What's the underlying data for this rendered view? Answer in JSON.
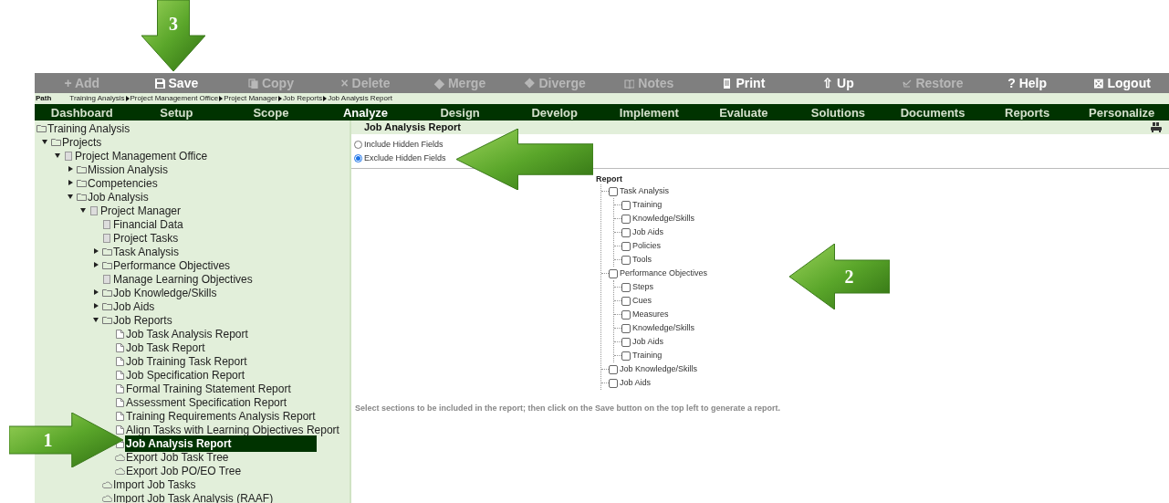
{
  "toolbar": [
    {
      "label": "Add",
      "glyph": "+",
      "disabled": true
    },
    {
      "label": "Save",
      "kind": "floppy",
      "disabled": false
    },
    {
      "label": "Copy",
      "kind": "copy",
      "disabled": true
    },
    {
      "label": "Delete",
      "glyph": "×",
      "disabled": true
    },
    {
      "label": "Merge",
      "glyph": "◆",
      "disabled": true
    },
    {
      "label": "Diverge",
      "glyph": "❖",
      "disabled": true
    },
    {
      "label": "Notes",
      "kind": "book",
      "disabled": true
    },
    {
      "label": "Print",
      "kind": "printer",
      "disabled": false
    },
    {
      "label": "Up",
      "glyph": "⇧",
      "disabled": false
    },
    {
      "label": "Restore",
      "kind": "restore",
      "disabled": true
    },
    {
      "label": "Help",
      "glyph": "?",
      "disabled": false
    },
    {
      "label": "Logout",
      "glyph": "⊠",
      "disabled": false
    }
  ],
  "path": {
    "label": "Path",
    "crumbs": [
      "Training Analysis",
      "Project Management Office",
      "Project Manager",
      "Job Reports",
      "Job Analysis Report"
    ]
  },
  "nav_tabs": [
    {
      "label": "Dashboard",
      "selected": false
    },
    {
      "label": "Setup",
      "selected": false
    },
    {
      "label": "Scope",
      "selected": false
    },
    {
      "label": "Analyze",
      "selected": true
    },
    {
      "label": "Design",
      "selected": false
    },
    {
      "label": "Develop",
      "selected": false
    },
    {
      "label": "Implement",
      "selected": false
    },
    {
      "label": "Evaluate",
      "selected": false
    },
    {
      "label": "Solutions",
      "selected": false
    },
    {
      "label": "Documents",
      "selected": false
    },
    {
      "label": "Reports",
      "selected": false
    },
    {
      "label": "Personalize",
      "selected": false
    }
  ],
  "sidebar": {
    "tree": [
      {
        "label": "Training Analysis",
        "kind": "folder",
        "selected": false,
        "children": [
          {
            "label": "Projects",
            "kind": "folder",
            "expanded": true,
            "selected": false,
            "children": [
              {
                "label": "Project Management Office",
                "kind": "clipboard",
                "expanded": true,
                "selected": false,
                "children": [
                  {
                    "label": "Mission Analysis",
                    "kind": "folder",
                    "expanded": false,
                    "selected": false
                  },
                  {
                    "label": "Competencies",
                    "kind": "folder",
                    "expanded": false,
                    "selected": false
                  },
                  {
                    "label": "Job Analysis",
                    "kind": "folder",
                    "expanded": true,
                    "selected": false,
                    "children": [
                      {
                        "label": "Project Manager",
                        "kind": "clipboard",
                        "expanded": true,
                        "selected": false,
                        "children": [
                          {
                            "label": "Financial Data",
                            "kind": "clipboard",
                            "selected": false
                          },
                          {
                            "label": "Project Tasks",
                            "kind": "clipboard",
                            "selected": false
                          },
                          {
                            "label": "Task Analysis",
                            "kind": "folder",
                            "expanded": false,
                            "selected": false
                          },
                          {
                            "label": "Performance Objectives",
                            "kind": "folder",
                            "expanded": false,
                            "selected": false
                          },
                          {
                            "label": "Manage Learning Objectives",
                            "kind": "clipboard",
                            "selected": false
                          },
                          {
                            "label": "Job Knowledge/Skills",
                            "kind": "folder",
                            "expanded": false,
                            "selected": false
                          },
                          {
                            "label": "Job Aids",
                            "kind": "folder",
                            "expanded": false,
                            "selected": false
                          },
                          {
                            "label": "Job Reports",
                            "kind": "folder",
                            "expanded": true,
                            "selected": false,
                            "children": [
                              {
                                "label": "Job Task Analysis Report",
                                "kind": "page",
                                "selected": false
                              },
                              {
                                "label": "Job Task Report",
                                "kind": "page",
                                "selected": false
                              },
                              {
                                "label": "Job Training Task Report",
                                "kind": "page",
                                "selected": false
                              },
                              {
                                "label": "Job Specification Report",
                                "kind": "page",
                                "selected": false
                              },
                              {
                                "label": "Formal Training Statement Report",
                                "kind": "page",
                                "selected": false
                              },
                              {
                                "label": "Assessment Specification Report",
                                "kind": "page",
                                "selected": false
                              },
                              {
                                "label": "Training Requirements Analysis Report",
                                "kind": "page",
                                "selected": false
                              },
                              {
                                "label": "Align Tasks with Learning Objectives Report",
                                "kind": "page",
                                "selected": false
                              },
                              {
                                "label": "Job Analysis Report",
                                "kind": "page",
                                "selected": true
                              },
                              {
                                "label": "Export Job Task Tree",
                                "kind": "cloud",
                                "selected": false
                              },
                              {
                                "label": "Export Job PO/EO Tree",
                                "kind": "cloud",
                                "selected": false
                              }
                            ]
                          },
                          {
                            "label": "Import Job Tasks",
                            "kind": "cloud",
                            "selected": false
                          },
                          {
                            "label": "Import Job Task Analysis (RAAF)",
                            "kind": "cloud",
                            "selected": false
                          }
                        ]
                      }
                    ]
                  }
                ]
              }
            ]
          }
        ]
      }
    ]
  },
  "panel": {
    "title": "Job Analysis Report",
    "options": [
      {
        "label": "Include Hidden Fields",
        "selected": false
      },
      {
        "label": "Exclude Hidden Fields",
        "selected": true
      }
    ],
    "report_tree": {
      "label": "Report",
      "children": [
        {
          "label": "Task Analysis",
          "checked": false,
          "children": [
            {
              "label": "Training",
              "checked": false
            },
            {
              "label": "Knowledge/Skills",
              "checked": false
            },
            {
              "label": "Job Aids",
              "checked": false
            },
            {
              "label": "Policies",
              "checked": false
            },
            {
              "label": "Tools",
              "checked": false
            }
          ]
        },
        {
          "label": "Performance Objectives",
          "checked": false,
          "children": [
            {
              "label": "Steps",
              "checked": false
            },
            {
              "label": "Cues",
              "checked": false
            },
            {
              "label": "Measures",
              "checked": false
            },
            {
              "label": "Knowledge/Skills",
              "checked": false
            },
            {
              "label": "Job Aids",
              "checked": false
            },
            {
              "label": "Training",
              "checked": false
            }
          ]
        },
        {
          "label": "Job Knowledge/Skills",
          "checked": false
        },
        {
          "label": "Job Aids",
          "checked": false
        }
      ]
    },
    "instructions": "Select sections to be included in the report; then click on the Save button on the top left to generate a report."
  },
  "callouts": [
    {
      "number": "3",
      "kind": "down"
    },
    {
      "kind": "left"
    },
    {
      "number": "2",
      "kind": "left"
    },
    {
      "number": "1",
      "kind": "right"
    }
  ]
}
